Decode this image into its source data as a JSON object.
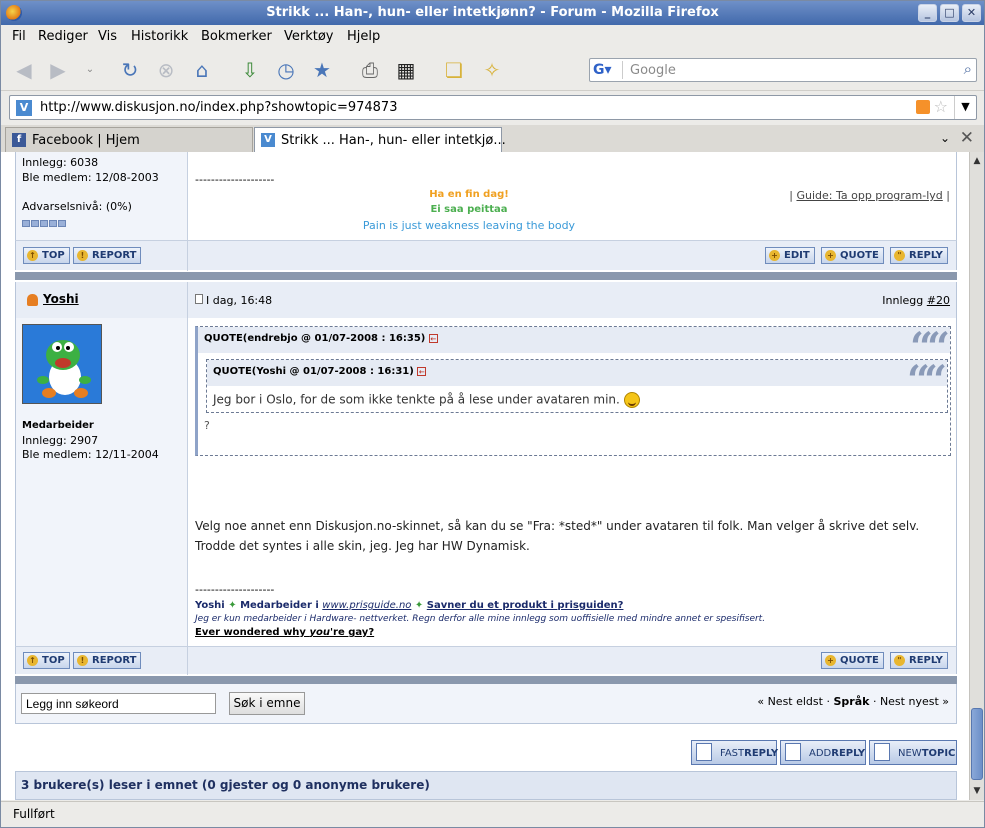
{
  "window": {
    "title": "Strikk ... Han-, hun- eller intetkjønn? - Forum - Mozilla Firefox"
  },
  "menu": [
    "Fil",
    "Rediger",
    "Vis",
    "Historikk",
    "Bokmerker",
    "Verktøy",
    "Hjelp"
  ],
  "search": {
    "placeholder": "Google"
  },
  "address": {
    "url": "http://www.diskusjon.no/index.php?showtopic=974873"
  },
  "tabs": [
    {
      "label": "Facebook | Hjem"
    },
    {
      "label": "Strikk ... Han-, hun- eller intetkjø..."
    }
  ],
  "prev_post": {
    "posts": "Innlegg: 6038",
    "member_since": "Ble medlem: 12/08-2003",
    "warning": "Advarselsnivå: (0%)",
    "sig_dashes": "--------------------",
    "sig_line1": "Ha en fin dag!",
    "sig_line2": "Ei saa peittaa",
    "sig_line3": "Pain is just weakness leaving the body",
    "sig_link_prefix": "|",
    "sig_link": "Guide: Ta opp program-lyd",
    "sig_link_suffix": "|"
  },
  "buttons": {
    "top": "TOP",
    "report": "REPORT",
    "edit": "EDIT",
    "quote": "QUOTE",
    "reply": "REPLY"
  },
  "post": {
    "author": "Yoshi",
    "time": "I dag, 16:48",
    "post_label": "Innlegg",
    "post_number": "#20",
    "role": "Medarbeider",
    "posts": "Innlegg: 2907",
    "member_since": "Ble medlem: 12/11-2004",
    "quote_outer_header": "QUOTE(endrebjo @ 01/07-2008 : 16:35)",
    "quote_inner_header": "QUOTE(Yoshi @ 01/07-2008 : 16:31)",
    "quote_inner_text": "Jeg bor i Oslo, for de som ikke tenkte på å lese under avataren min.",
    "quote_outer_text": "?",
    "body": "Velg noe annet enn Diskusjon.no-skinnet, så kan du se \"Fra: *sted*\" under avataren til folk. Man velger å skrive det selv. Trodde det syntes i alle skin, jeg. Jeg har HW Dynamisk.",
    "sig_dashes": "--------------------",
    "sig_name": "Yoshi",
    "sig_role": "Medarbeider i",
    "sig_site": "www.prisguide.no",
    "sig_link": "Savner du et produkt i prisguiden?",
    "sig_disclaimer": "Jeg er kun medarbeider i Hardware- nettverket. Regn derfor alle mine innlegg som uoffisielle med mindre annet er spesifisert.",
    "sig_gay_pre": "Ever wondered why ",
    "sig_gay_em": "you",
    "sig_gay_post": "'re gay?"
  },
  "search_topic": {
    "value": "Legg inn søkeord",
    "button": "Søk i emne"
  },
  "nav": {
    "older": "« Nest eldst",
    "lang": "Språk",
    "newer": "Nest nyest »",
    "dot1": "·",
    "dot2": "·"
  },
  "big_buttons": [
    {
      "pre": "FAST",
      "bold": "REPLY"
    },
    {
      "pre": "ADD",
      "bold": "REPLY"
    },
    {
      "pre": "NEW",
      "bold": "TOPIC"
    }
  ],
  "readers": "3 brukere(s) leser i emnet (0 gjester og 0 anonyme brukere)",
  "status": "Fullført"
}
